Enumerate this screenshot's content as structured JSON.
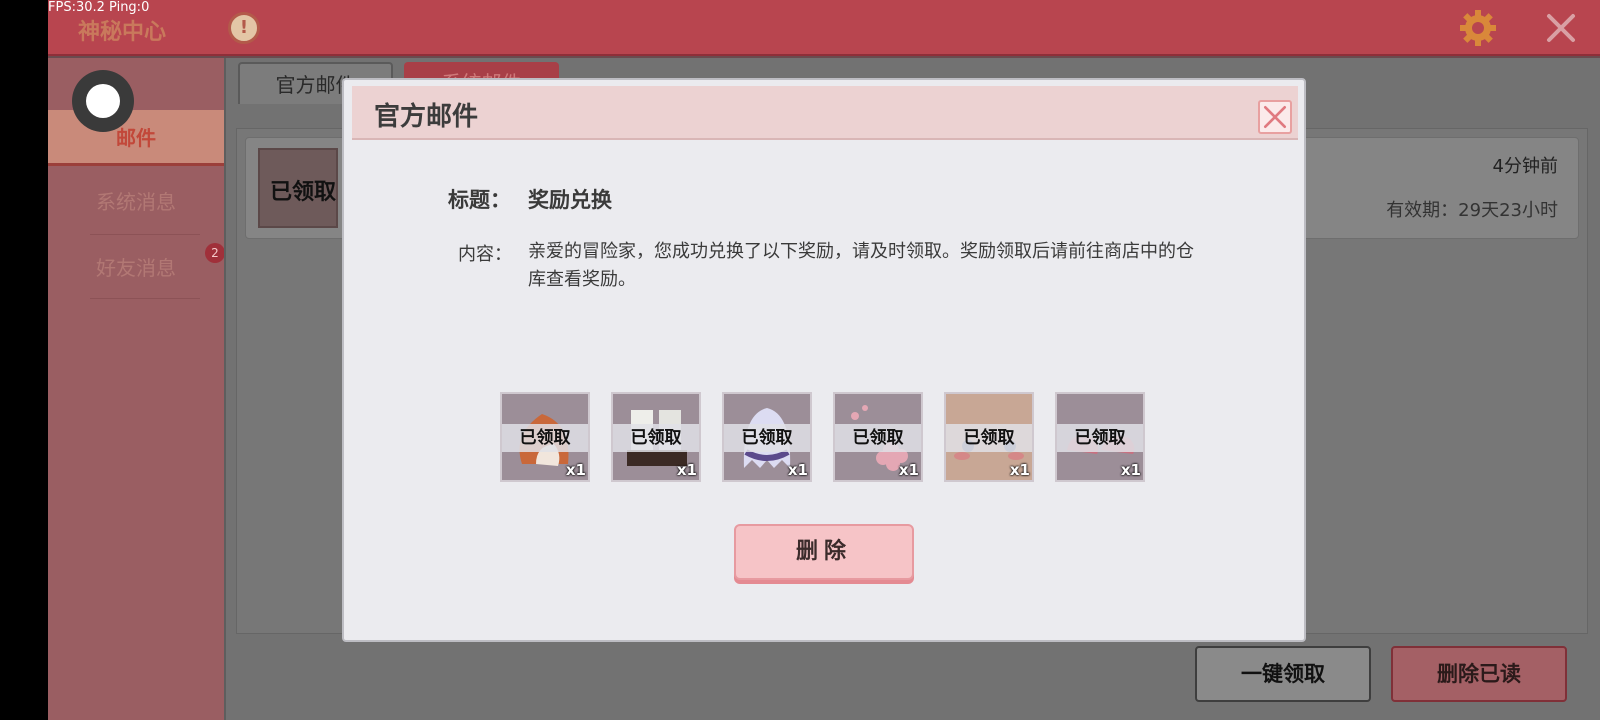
{
  "overlay": {
    "fps": "FPS:30.2  Ping:0"
  },
  "header": {
    "title": "神秘中心"
  },
  "sidebar": {
    "items": [
      {
        "label": "邮件"
      },
      {
        "label": "系统消息"
      },
      {
        "label": "好友消息"
      }
    ],
    "badge": "2"
  },
  "tabs": [
    {
      "label": "官方邮件"
    },
    {
      "label": "系统邮件"
    }
  ],
  "mail_list": [
    {
      "stamp": "已领取",
      "time": "4分钟前",
      "expire": "有效期：29天23小时"
    }
  ],
  "footer": {
    "claim_all": "一键领取",
    "delete_read": "删除已读"
  },
  "modal": {
    "title": "官方邮件",
    "subject_label": "标题：",
    "subject": "奖励兑换",
    "content_label": "内容：",
    "content": "亲爱的冒险家，您成功兑换了以下奖励，请及时领取。奖励领取后请前往商店中的仓库查看奖励。",
    "rewards": [
      {
        "name": "fox-tail-icon",
        "stamp": "已领取",
        "qty": "x1"
      },
      {
        "name": "boots-icon",
        "stamp": "已领取",
        "qty": "x1"
      },
      {
        "name": "ghost-cloak-icon",
        "stamp": "已领取",
        "qty": "x1"
      },
      {
        "name": "sakura-icon",
        "stamp": "已领取",
        "qty": "x1"
      },
      {
        "name": "face-icon",
        "stamp": "已领取",
        "qty": "x1"
      },
      {
        "name": "shoes-icon",
        "stamp": "已领取",
        "qty": "x1"
      }
    ],
    "delete_label": "删除"
  }
}
